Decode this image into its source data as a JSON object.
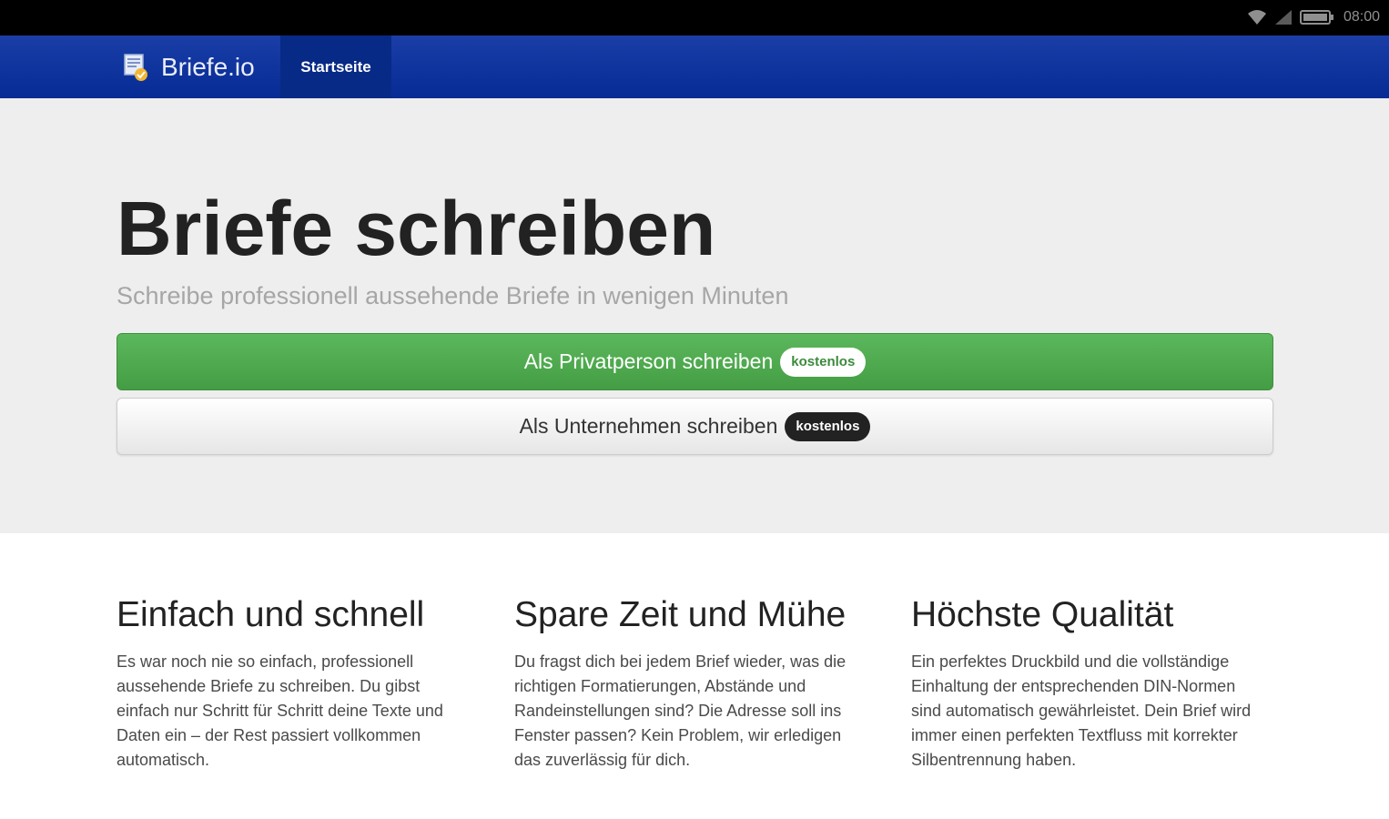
{
  "status_bar": {
    "time": "08:00"
  },
  "navbar": {
    "brand": "Briefe.io",
    "active_item": "Startseite"
  },
  "hero": {
    "title": "Briefe schreiben",
    "subtitle": "Schreibe professionell aussehende Briefe in wenigen Minuten",
    "primary_button": {
      "label": "Als Privatperson schreiben",
      "badge": "kostenlos"
    },
    "secondary_button": {
      "label": "Als Unternehmen schreiben",
      "badge": "kostenlos"
    }
  },
  "features": [
    {
      "title": "Einfach und schnell",
      "text": "Es war noch nie so einfach, professionell aussehende Briefe zu schreiben. Du gibst einfach nur Schritt für Schritt deine Texte und Daten ein – der Rest passiert vollkommen automatisch."
    },
    {
      "title": "Spare Zeit und Mühe",
      "text": "Du fragst dich bei jedem Brief wieder, was die richtigen Formatierungen, Abstände und Randeinstellungen sind? Die Adresse soll ins Fenster passen? Kein Problem, wir erledigen das zuverlässig für dich."
    },
    {
      "title": "Höchste Qualität",
      "text": "Ein perfektes Druckbild und die vollständige Einhaltung der entsprechenden DIN-Normen sind automatisch gewährleistet. Dein Brief wird immer einen perfekten Textfluss mit korrekter Silbentrennung haben."
    }
  ],
  "colors": {
    "navbar": "#0a309c",
    "primary_button": "#4cae4c",
    "hero_background": "#eeeeee"
  }
}
